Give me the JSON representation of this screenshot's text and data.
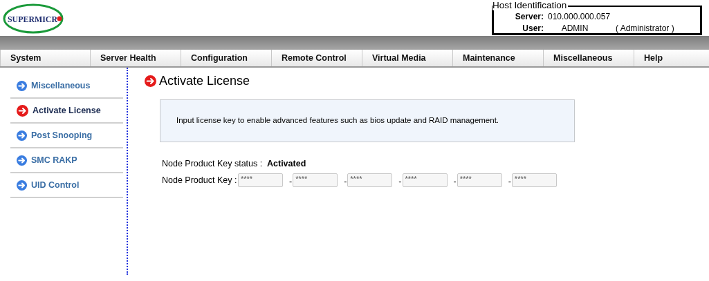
{
  "logo": "SUPERMICR",
  "host_identification": {
    "legend": "Host Identification",
    "server_label": "Server:",
    "server": "010.000.000.057",
    "user_label": "User:",
    "user": "ADMIN",
    "role": "( Administrator )"
  },
  "menu": [
    {
      "label": "System"
    },
    {
      "label": "Server Health"
    },
    {
      "label": "Configuration"
    },
    {
      "label": "Remote Control"
    },
    {
      "label": "Virtual Media"
    },
    {
      "label": "Maintenance"
    },
    {
      "label": "Miscellaneous"
    },
    {
      "label": "Help"
    }
  ],
  "sidebar": {
    "items": [
      {
        "label": "Miscellaneous",
        "selected": false
      },
      {
        "label": "Activate License",
        "selected": true
      },
      {
        "label": "Post Snooping",
        "selected": false
      },
      {
        "label": "SMC RAKP",
        "selected": false
      },
      {
        "label": "UID Control",
        "selected": false
      }
    ]
  },
  "page": {
    "title": "Activate License",
    "info": "Input license key to enable advanced features such as bios update and RAID management.",
    "status_label": "Node Product Key status :",
    "status": "Activated",
    "key_label": "Node Product Key :",
    "key_fields": [
      {
        "value": "****",
        "disabled": true
      },
      {
        "separator": "-",
        "value": "****",
        "disabled": true
      },
      {
        "separator": "-",
        "value": "****",
        "disabled": true
      },
      {
        "separator": "-",
        "value": "****",
        "disabled": true
      },
      {
        "separator": "-",
        "value": "****",
        "disabled": true
      },
      {
        "separator": "-",
        "value": "****",
        "disabled": true
      }
    ]
  }
}
